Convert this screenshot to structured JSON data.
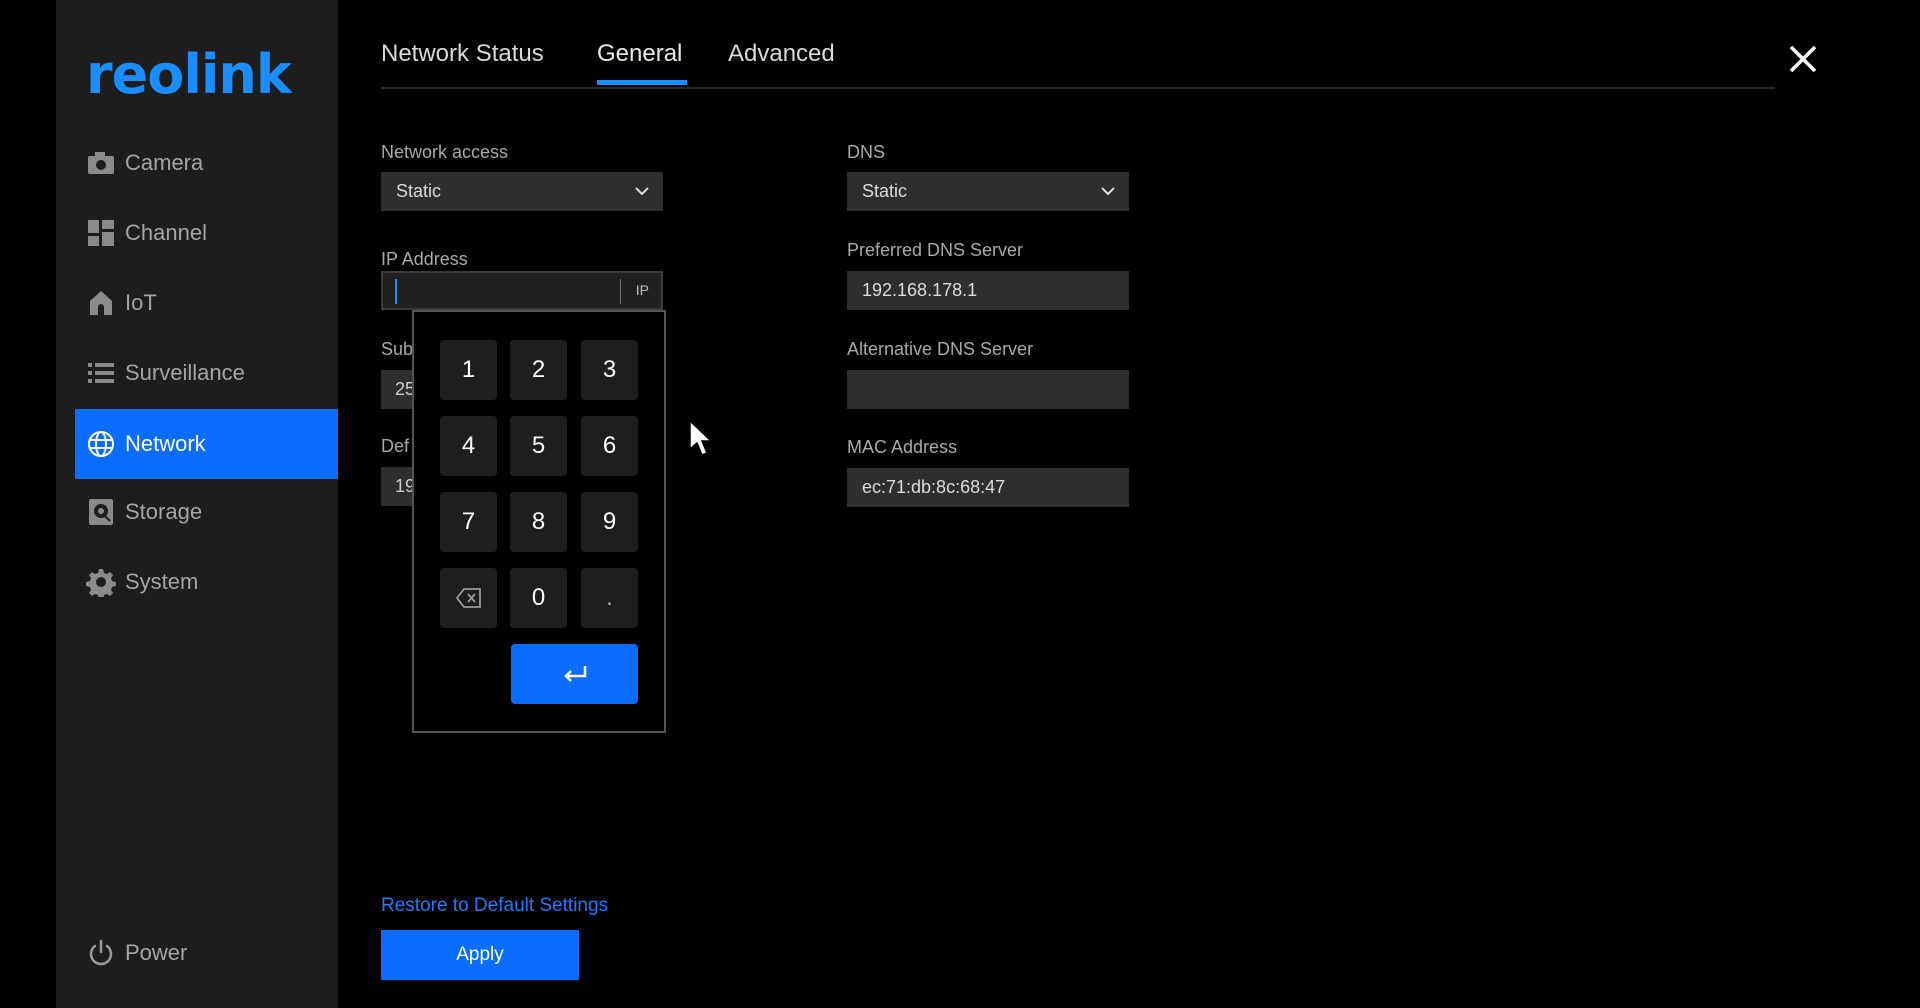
{
  "app": {
    "logo_text": "reolink",
    "accent_color": "#0a6dff"
  },
  "sidebar": {
    "items": [
      {
        "label": "Camera",
        "icon": "camera-icon"
      },
      {
        "label": "Channel",
        "icon": "grid-icon"
      },
      {
        "label": "IoT",
        "icon": "home-icon"
      },
      {
        "label": "Surveillance",
        "icon": "list-icon"
      },
      {
        "label": "Network",
        "icon": "globe-icon",
        "active": true
      },
      {
        "label": "Storage",
        "icon": "storage-icon"
      },
      {
        "label": "System",
        "icon": "gear-icon"
      }
    ],
    "power": {
      "label": "Power",
      "icon": "power-icon"
    }
  },
  "tabs": [
    {
      "label": "Network Status"
    },
    {
      "label": "General",
      "active": true
    },
    {
      "label": "Advanced"
    }
  ],
  "form": {
    "network_access": {
      "label": "Network access",
      "value": "Static"
    },
    "ip_address": {
      "label": "IP Address",
      "value": "",
      "tag": "IP"
    },
    "subnet": {
      "label_visible": "Sub",
      "value_visible": "25"
    },
    "gateway": {
      "label_visible": "Def",
      "value_visible": "19"
    },
    "dns": {
      "label": "DNS",
      "value": "Static"
    },
    "preferred_dns": {
      "label": "Preferred DNS Server",
      "value": "192.168.178.1"
    },
    "alternative_dns": {
      "label": "Alternative DNS Server",
      "value": ""
    },
    "mac": {
      "label": "MAC Address",
      "value": "ec:71:db:8c:68:47"
    }
  },
  "keypad": {
    "keys": [
      "1",
      "2",
      "3",
      "4",
      "5",
      "6",
      "7",
      "8",
      "9",
      "backspace",
      "0",
      "."
    ],
    "enter_icon": "enter-icon"
  },
  "actions": {
    "restore_label": "Restore to Default Settings",
    "apply_label": "Apply"
  }
}
